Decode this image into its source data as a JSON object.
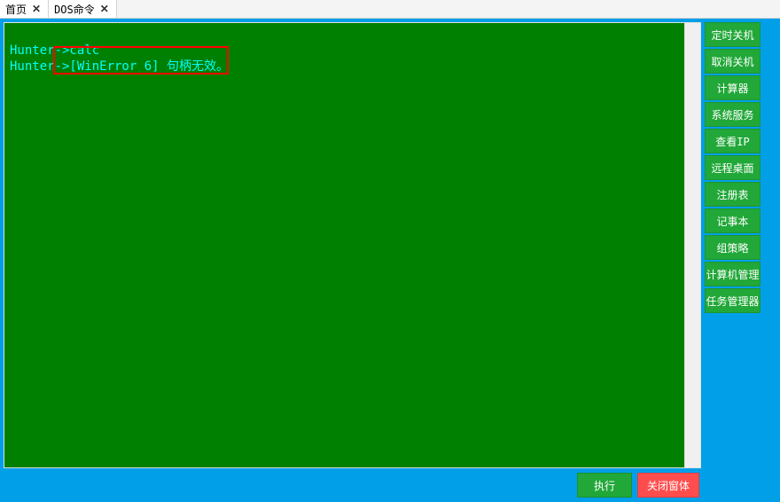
{
  "tabs": [
    {
      "label": "首页",
      "close": "✕"
    },
    {
      "label": "DOS命令",
      "close": "✕"
    }
  ],
  "terminal": {
    "lines": [
      "Hunter->calc",
      "Hunter->[WinError 6] 句柄无效。"
    ]
  },
  "bottom": {
    "execute": "执行",
    "close_window": "关闭窗体"
  },
  "side_buttons": [
    "定时关机",
    "取消关机",
    "计算器",
    "系统服务",
    "查看IP",
    "远程桌面",
    "注册表",
    "记事本",
    "组策略",
    "计算机管理",
    "任务管理器"
  ]
}
